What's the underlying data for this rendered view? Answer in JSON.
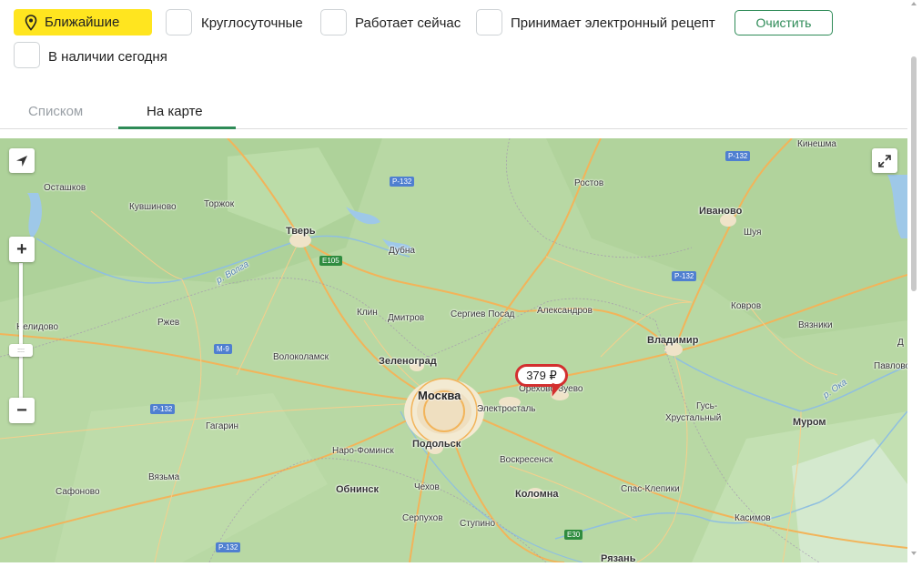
{
  "filters": {
    "nearest_label": "Ближайшие",
    "nearest_active": true,
    "options": [
      {
        "label": "Круглосуточные",
        "checked": false
      },
      {
        "label": "Работает сейчас",
        "checked": false
      },
      {
        "label": "Принимает электронный рецепт",
        "checked": false
      },
      {
        "label": "В наличии сегодня",
        "checked": false
      }
    ],
    "clear_label": "Очистить"
  },
  "tabs": [
    {
      "label": "Списком",
      "active": false
    },
    {
      "label": "На карте",
      "active": true
    }
  ],
  "map": {
    "price_marker": "379 ₽",
    "cities": {
      "moscow": "Москва",
      "tver": "Тверь",
      "ivanovo": "Иваново",
      "vladimir": "Владимир",
      "zelenograd": "Зеленоград",
      "podolsk": "Подольск",
      "elektrostal": "Электросталь",
      "orekhovo": "Орехово-Зуево",
      "murom": "Муром",
      "ostashkov": "Осташков",
      "kuvshinovo": "Кувшиново",
      "torzhok": "Торжок",
      "rostov": "Ростов",
      "kineshma": "Кинешма",
      "shuya": "Шуя",
      "dubna": "Дубна",
      "klin": "Клин",
      "dmitrov": "Дмитров",
      "sergiev_posad": "Сергиев Посад",
      "aleksandrov": "Александров",
      "kovrov": "Ковров",
      "vyazniki": "Вязники",
      "nelidovo": "Нелидово",
      "rzhev": "Ржев",
      "volokolamsk": "Волоколамск",
      "pavlovo": "Павлово",
      "gagarin": "Гагарин",
      "naro_fominsk": "Наро-Фоминск",
      "voskresensk": "Воскресенск",
      "gus_khrustalny_1": "Гусь-",
      "gus_khrustalny_2": "Хрустальный",
      "vyazma": "Вязьма",
      "safonovo": "Сафоново",
      "obninsk": "Обнинск",
      "chekhov": "Чехов",
      "kolomna": "Коломна",
      "spas_klepiki": "Спас-Клепики",
      "serpukhov": "Серпухов",
      "stupino": "Ступино",
      "kasimov": "Касимов",
      "ryazan": "Рязань",
      "edge_d": "Д"
    },
    "water": {
      "volga": "р. Волга",
      "oka": "р. Ока"
    },
    "roads": {
      "r132_a": "Р-132",
      "r132_b": "Р-132",
      "r132_c": "Р-132",
      "r132_d": "Р-132",
      "r132_e": "Р-132",
      "e105": "E105",
      "m9": "М-9",
      "e30": "E30"
    },
    "controls": {
      "zoom_in": "+",
      "zoom_out": "−",
      "handle": "::::"
    }
  },
  "colors": {
    "accent_green": "#2e8b57",
    "nearest_chip": "#ffe51f",
    "marker_red": "#d32f2f",
    "map_land": "#b9d9a5"
  }
}
